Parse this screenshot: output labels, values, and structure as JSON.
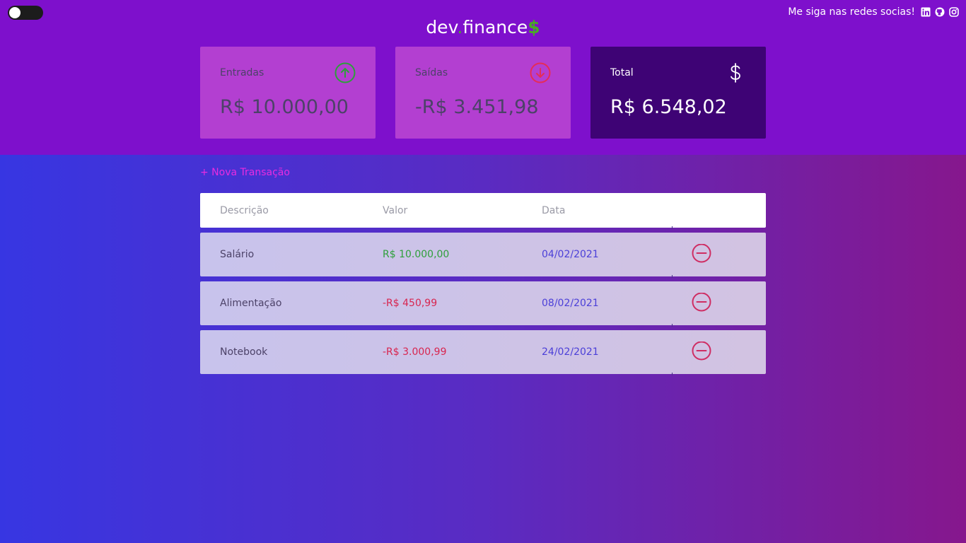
{
  "theme_toggle": {
    "state": "off"
  },
  "social": {
    "label": "Me siga nas redes socias!",
    "icons": [
      "linkedin-icon",
      "github-icon",
      "instagram-icon"
    ]
  },
  "logo": {
    "part1": "dev",
    "dot": ".",
    "part2": "finance",
    "suffix": "$"
  },
  "cards": {
    "income": {
      "title": "Entradas",
      "amount": "R$ 10.000,00",
      "icon": "arrow-up-circle-icon"
    },
    "expense": {
      "title": "Saídas",
      "amount": "-R$ 3.451,98",
      "icon": "arrow-down-circle-icon"
    },
    "total": {
      "title": "Total",
      "amount": "R$ 6.548,02",
      "icon": "dollar-icon"
    }
  },
  "new_transaction": "+ Nova Transação",
  "table": {
    "headers": [
      "Descrição",
      "Valor",
      "Data"
    ],
    "rows": [
      {
        "description": "Salário",
        "value": "R$ 10.000,00",
        "date": "04/02/2021",
        "type": "income"
      },
      {
        "description": "Alimentação",
        "value": "-R$ 450,99",
        "date": "08/02/2021",
        "type": "expense"
      },
      {
        "description": "Notebook",
        "value": "-R$ 3.000,99",
        "date": "24/02/2021",
        "type": "expense"
      }
    ]
  },
  "colors": {
    "header_bg": "#7e10cc",
    "card_bg": "#b33fd1",
    "total_bg": "#3e0375",
    "income": "#2e9f3b",
    "expense": "#d8254f",
    "accent": "#e92be0"
  }
}
